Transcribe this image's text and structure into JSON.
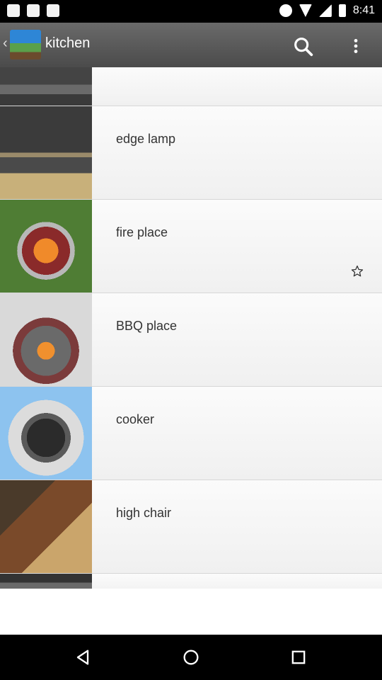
{
  "status_bar": {
    "time": "8:41"
  },
  "app_bar": {
    "title": "kitchen"
  },
  "list": {
    "items": [
      {
        "label": ""
      },
      {
        "label": "edge lamp"
      },
      {
        "label": "fire place"
      },
      {
        "label": "BBQ place"
      },
      {
        "label": "cooker"
      },
      {
        "label": "high chair"
      },
      {
        "label": ""
      }
    ]
  },
  "icons": {
    "back": "back-arrow-icon",
    "search": "search-icon",
    "more": "more-vertical-icon",
    "star": "star-outline-icon",
    "nav_back": "nav-back-icon",
    "nav_home": "nav-home-icon",
    "nav_recents": "nav-recents-icon"
  },
  "colors": {
    "appbar": "#555555",
    "status_bar": "#000000",
    "row_bg": "#f6f6f6"
  }
}
